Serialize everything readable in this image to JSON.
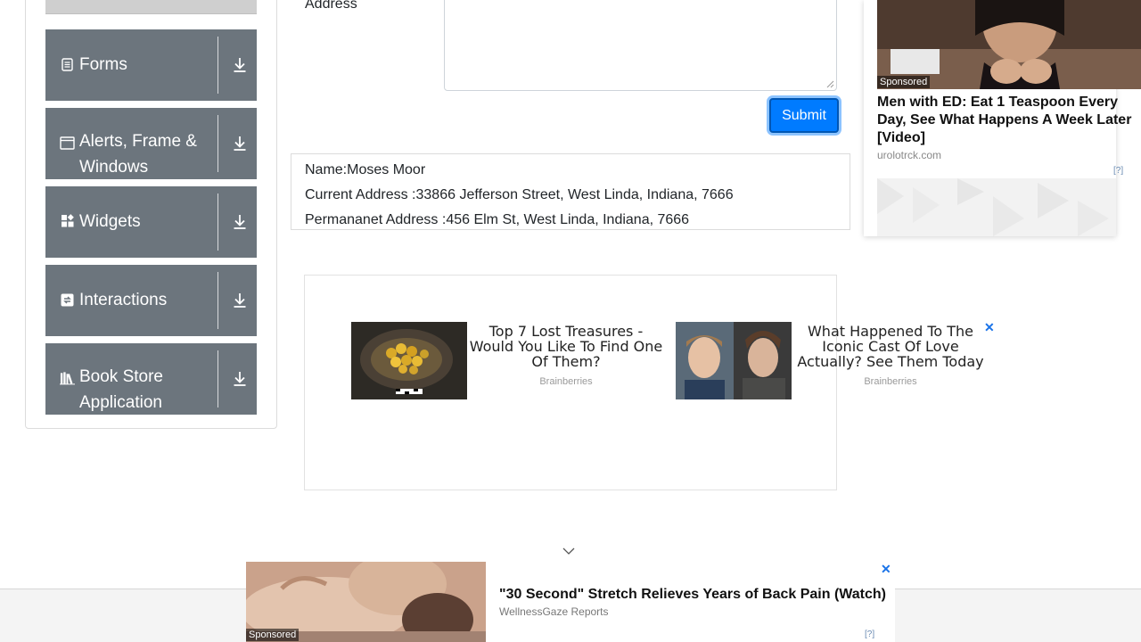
{
  "sidebar": {
    "groups": [
      {
        "label": "Forms",
        "icon": "form-icon"
      },
      {
        "label": "Alerts, Frame & Windows",
        "icon": "window-icon"
      },
      {
        "label": "Widgets",
        "icon": "widgets-icon"
      },
      {
        "label": "Interactions",
        "icon": "interactions-icon"
      },
      {
        "label": "Book Store Application",
        "icon": "book-icon"
      }
    ]
  },
  "form": {
    "address_label": "Address",
    "submit_label": "Submit"
  },
  "output": {
    "name": "Name:Moses Moor",
    "current_address": "Current Address :33866 Jefferson Street, West Linda, Indiana, 7666",
    "permanent_address": "Permananet Address :456 Elm St, West Linda, Indiana, 7666"
  },
  "center_ad": {
    "cards": [
      {
        "title": "Top 7 Lost Treasures - Would You Like To Find One Of Them?",
        "source": "Brainberries"
      },
      {
        "title": "What Happened To The Iconic Cast Of Love Actually? See Them Today",
        "source": "Brainberries"
      }
    ],
    "close": "✕"
  },
  "right_ad": {
    "sponsored": "Sponsored",
    "title": "Men with ED: Eat 1 Teaspoon Every Day, See What Happens A Week Later [Video]",
    "source": "urolotrck.com",
    "adchoice": "[?]"
  },
  "bottom_ad": {
    "sponsored": "Sponsored",
    "title": "\"30 Second\" Stretch Relieves Years of Back Pain (Watch)",
    "source": "WellnessGaze Reports",
    "close": "✕",
    "adchoice": "[?]"
  },
  "colors": {
    "sidebar_group": "#6c757d",
    "submit": "#007bff",
    "ad_close": "#1a73e8"
  }
}
